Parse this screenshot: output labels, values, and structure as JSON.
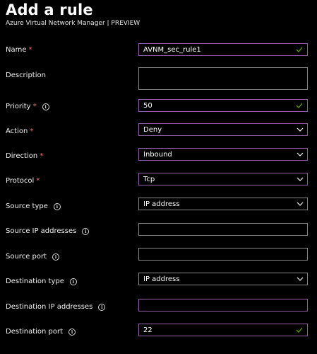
{
  "header": {
    "title": "Add a rule",
    "subtitle": "Azure Virtual Network Manager | PREVIEW"
  },
  "form": {
    "name": {
      "label": "Name",
      "value": "AVNM_sec_rule1"
    },
    "description": {
      "label": "Description",
      "value": ""
    },
    "priority": {
      "label": "Priority",
      "value": "50"
    },
    "action": {
      "label": "Action",
      "value": "Deny"
    },
    "direction": {
      "label": "Direction",
      "value": "Inbound"
    },
    "protocol": {
      "label": "Protocol",
      "value": "Tcp"
    },
    "source_type": {
      "label": "Source type",
      "value": "IP address"
    },
    "source_ip": {
      "label": "Source IP addresses",
      "value": ""
    },
    "source_port": {
      "label": "Source port",
      "value": ""
    },
    "destination_type": {
      "label": "Destination type",
      "value": "IP address"
    },
    "destination_ip": {
      "label": "Destination IP addresses",
      "value": ""
    },
    "destination_port": {
      "label": "Destination port",
      "value": "22"
    }
  },
  "colors": {
    "required": "#f1707b",
    "valid": "#57a300",
    "focus_border": "#8e5ea2",
    "border": "#8a8886"
  }
}
